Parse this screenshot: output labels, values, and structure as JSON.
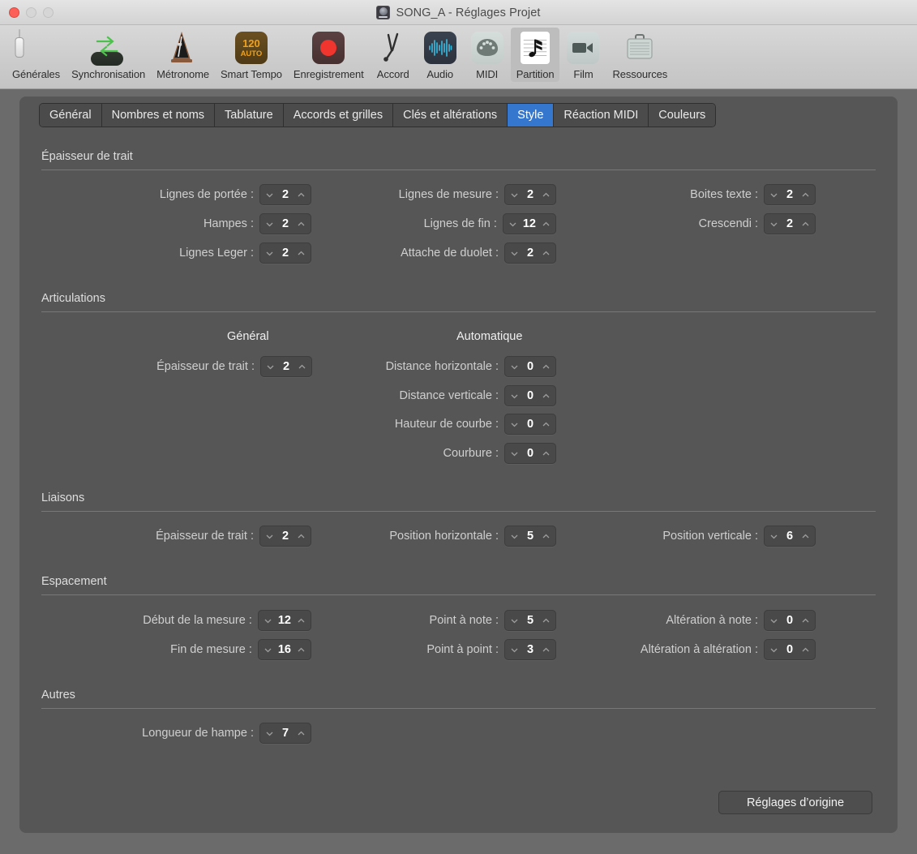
{
  "window": {
    "title": "SONG_A - Réglages Projet",
    "traffic_lights": [
      "close",
      "minimize",
      "zoom"
    ],
    "project_icon": "project-disc-icon"
  },
  "toolbar": {
    "items": [
      {
        "label": "Générales",
        "icon": "switch-icon",
        "selected": false
      },
      {
        "label": "Synchronisation",
        "icon": "sync-arrows-icon",
        "selected": false
      },
      {
        "label": "Métronome",
        "icon": "metronome-icon",
        "selected": false
      },
      {
        "label": "Smart Tempo",
        "icon": "tempo-auto-icon",
        "selected": false,
        "badge_value": "120",
        "badge_mode": "AUTO"
      },
      {
        "label": "Enregistrement",
        "icon": "record-icon",
        "selected": false
      },
      {
        "label": "Accord",
        "icon": "tuning-fork-icon",
        "selected": false
      },
      {
        "label": "Audio",
        "icon": "waveform-icon",
        "selected": false
      },
      {
        "label": "MIDI",
        "icon": "midi-port-icon",
        "selected": false
      },
      {
        "label": "Partition",
        "icon": "music-score-icon",
        "selected": true
      },
      {
        "label": "Film",
        "icon": "video-camera-icon",
        "selected": false
      },
      {
        "label": "Ressources",
        "icon": "briefcase-icon",
        "selected": false
      }
    ]
  },
  "tabs": [
    {
      "label": "Général",
      "active": false
    },
    {
      "label": "Nombres et noms",
      "active": false
    },
    {
      "label": "Tablature",
      "active": false
    },
    {
      "label": "Accords et grilles",
      "active": false
    },
    {
      "label": "Clés et altérations",
      "active": false
    },
    {
      "label": "Style",
      "active": true
    },
    {
      "label": "Réaction MIDI",
      "active": false
    },
    {
      "label": "Couleurs",
      "active": false
    }
  ],
  "sections": {
    "line_thickness": {
      "title": "Épaisseur de trait",
      "fields": {
        "staff_lines": {
          "label": "Lignes de portée :",
          "value": "2"
        },
        "stems": {
          "label": "Hampes :",
          "value": "2"
        },
        "ledger_lines": {
          "label": "Lignes Leger :",
          "value": "2"
        },
        "bar_lines": {
          "label": "Lignes de mesure :",
          "value": "2"
        },
        "end_lines": {
          "label": "Lignes de fin :",
          "value": "12"
        },
        "tuplet_bracket": {
          "label": "Attache de duolet :",
          "value": "2"
        },
        "text_boxes": {
          "label": "Boites texte :",
          "value": "2"
        },
        "crescendi": {
          "label": "Crescendi :",
          "value": "2"
        }
      }
    },
    "articulations": {
      "title": "Articulations",
      "col_general": "Général",
      "col_automatic": "Automatique",
      "fields": {
        "line_thickness": {
          "label": "Épaisseur de trait :",
          "value": "2"
        },
        "horiz_distance": {
          "label": "Distance horizontale :",
          "value": "0"
        },
        "vert_distance": {
          "label": "Distance verticale :",
          "value": "0"
        },
        "curve_height": {
          "label": "Hauteur de courbe :",
          "value": "0"
        },
        "curvature": {
          "label": "Courbure :",
          "value": "0"
        }
      }
    },
    "ties": {
      "title": "Liaisons",
      "fields": {
        "line_thickness": {
          "label": "Épaisseur de trait :",
          "value": "2"
        },
        "horiz_position": {
          "label": "Position horizontale :",
          "value": "5"
        },
        "vert_position": {
          "label": "Position verticale :",
          "value": "6"
        }
      }
    },
    "spacing": {
      "title": "Espacement",
      "fields": {
        "bar_start": {
          "label": "Début de la mesure :",
          "value": "12"
        },
        "bar_end": {
          "label": "Fin de mesure :",
          "value": "16"
        },
        "dot_to_note": {
          "label": "Point à note :",
          "value": "5"
        },
        "dot_to_dot": {
          "label": "Point à point :",
          "value": "3"
        },
        "accidental_note": {
          "label": "Altération à note :",
          "value": "0"
        },
        "accidental_accid": {
          "label": "Altération à altération :",
          "value": "0"
        }
      }
    },
    "others": {
      "title": "Autres",
      "fields": {
        "stem_length": {
          "label": "Longueur de hampe :",
          "value": "7"
        }
      }
    }
  },
  "reset_button": {
    "label": "Réglages d’origine"
  },
  "colors": {
    "accent_tab": "#3577cf",
    "pane_bg": "#565656",
    "window_bg": "#6b6b6b",
    "stepper_bg": "#494949",
    "record_red": "#f0342e",
    "tempo_orange": "#f0a019",
    "sync_green": "#4cc24c",
    "audio_cyan": "#39b6d8"
  }
}
